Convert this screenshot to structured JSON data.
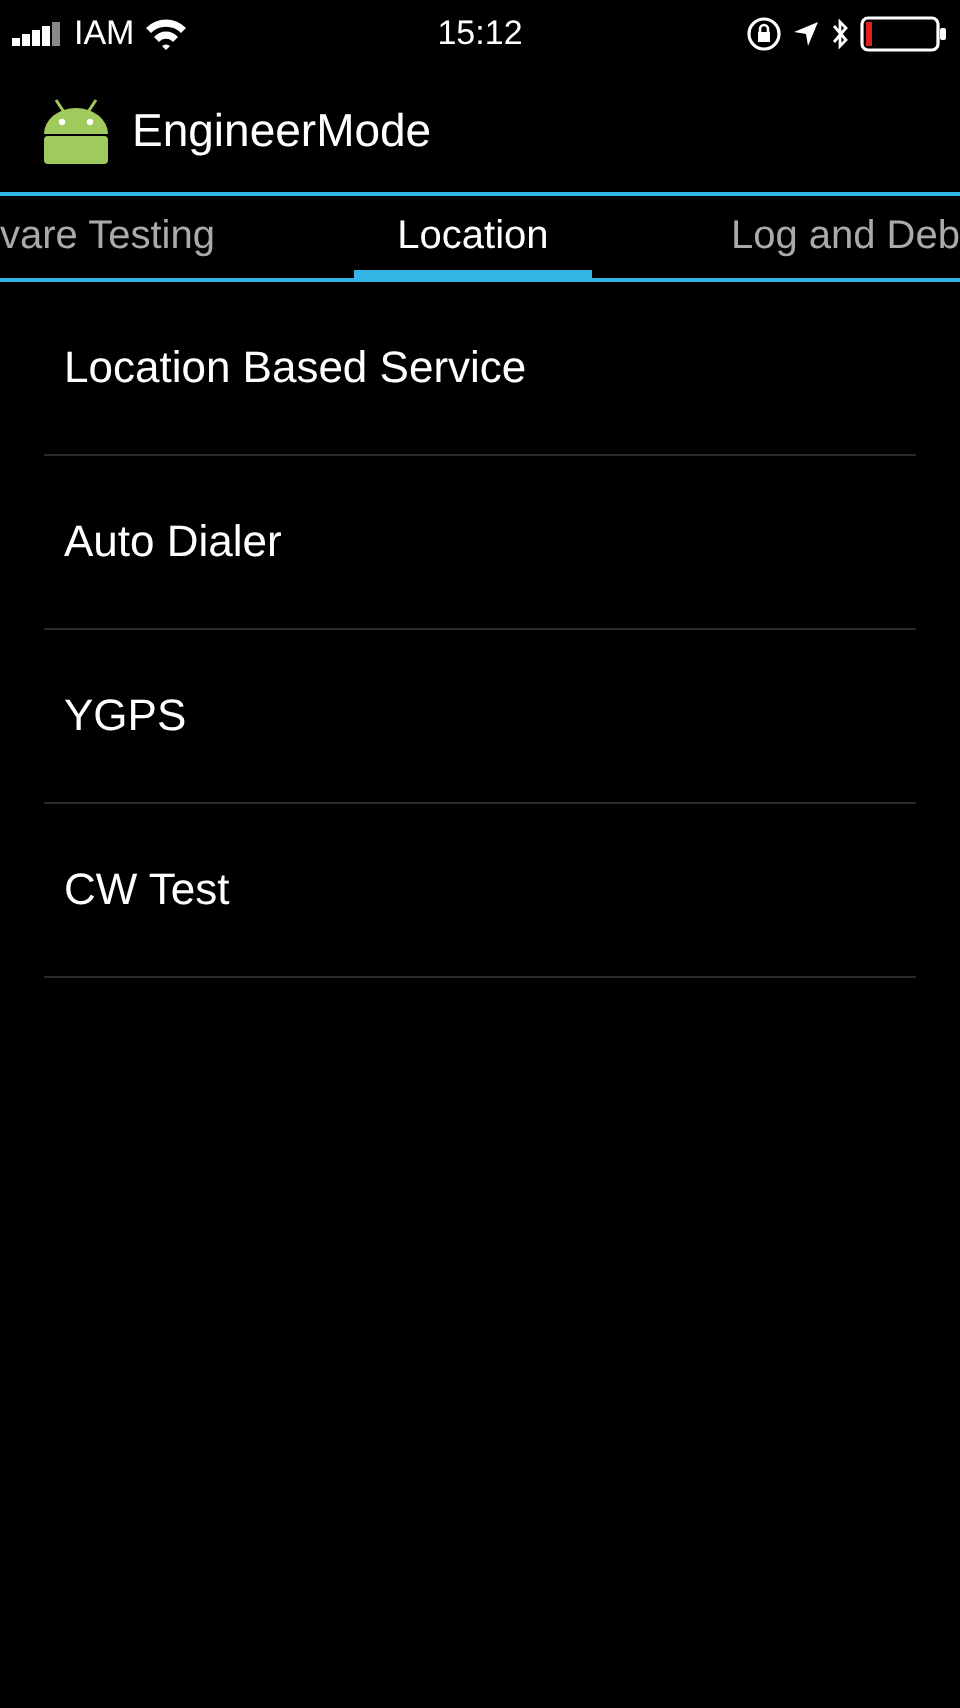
{
  "status_bar": {
    "carrier": "IAM",
    "time": "15:12"
  },
  "app_bar": {
    "title": "EngineerMode"
  },
  "tabs": [
    {
      "label": "vare Testing",
      "selected": false
    },
    {
      "label": "Location",
      "selected": true
    },
    {
      "label": "Log and Deb",
      "selected": false
    }
  ],
  "items": [
    {
      "label": "Location Based Service"
    },
    {
      "label": "Auto Dialer"
    },
    {
      "label": "YGPS"
    },
    {
      "label": "CW Test"
    }
  ]
}
